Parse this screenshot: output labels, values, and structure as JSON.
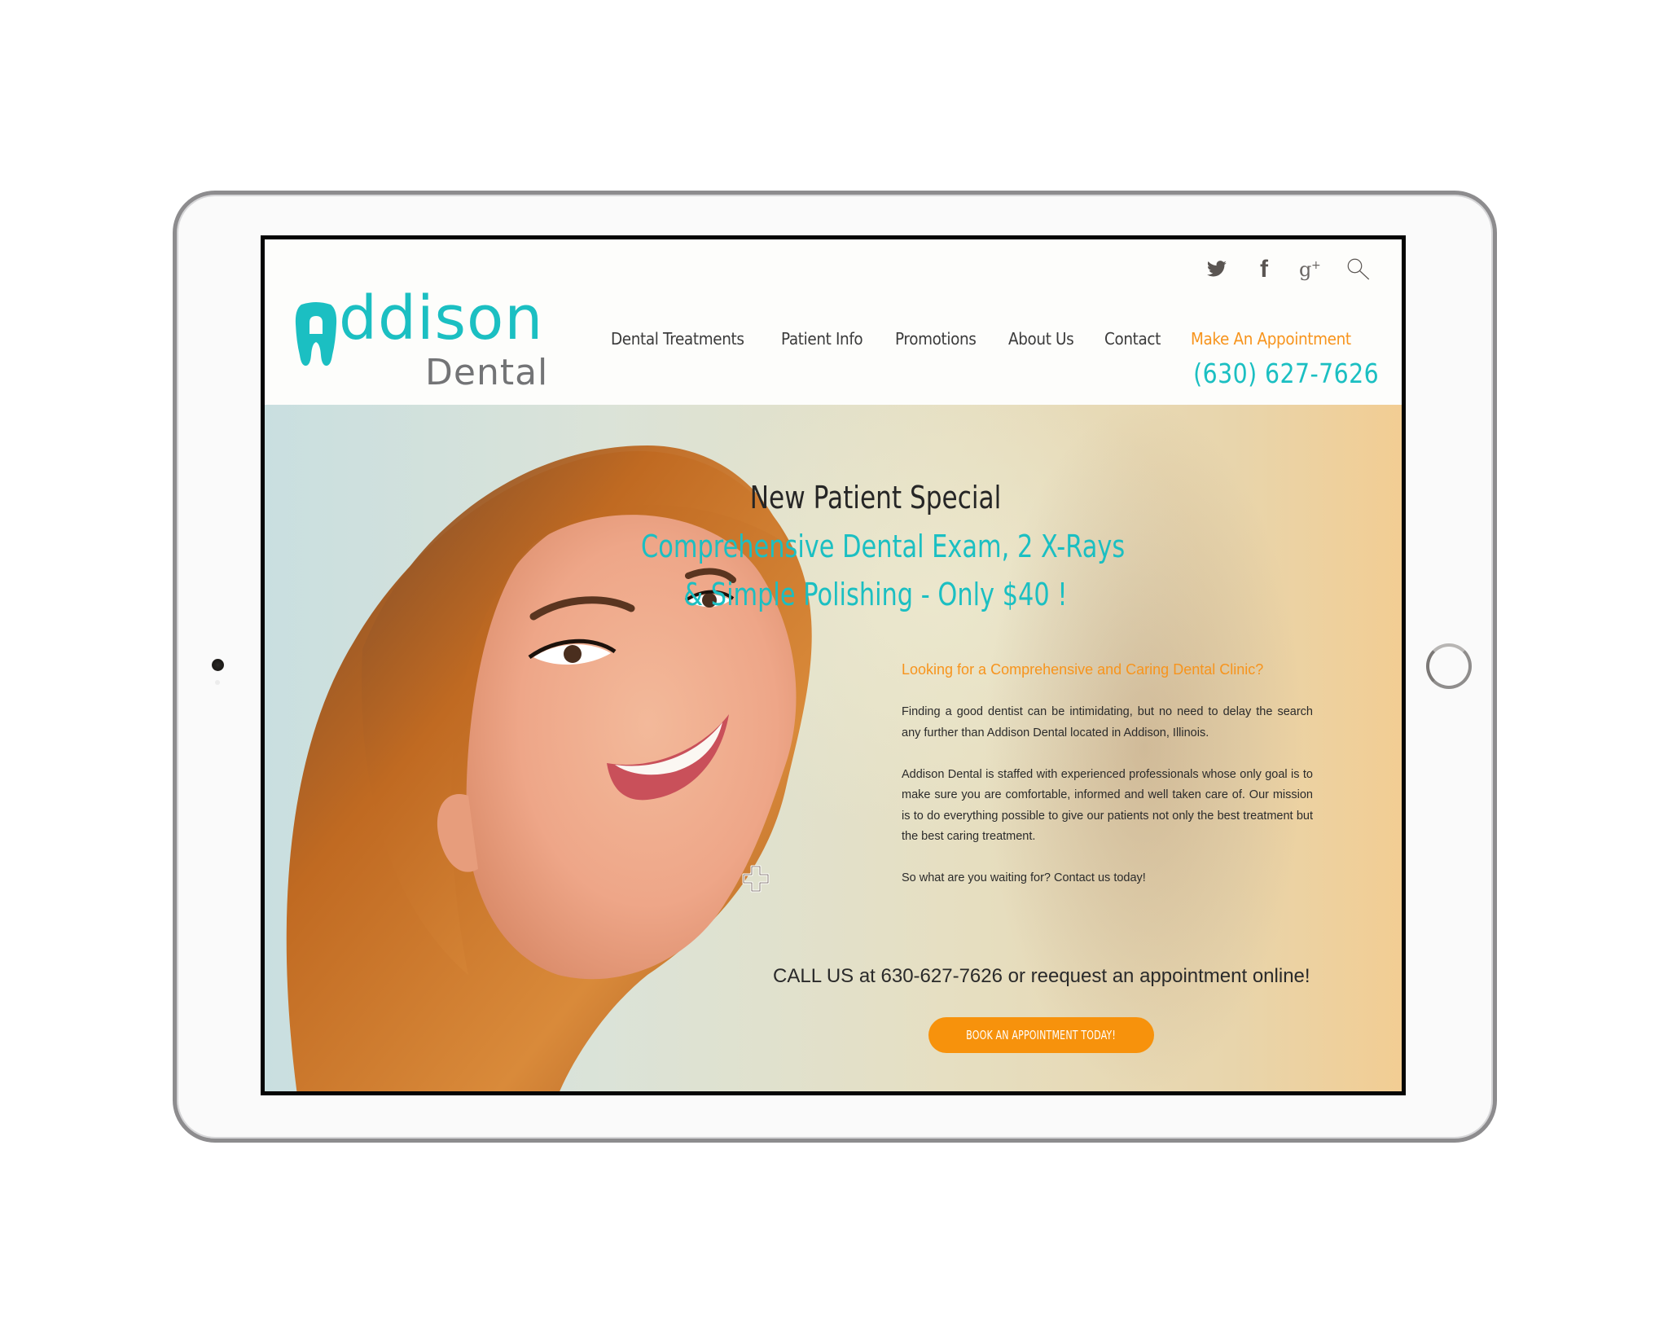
{
  "site": {
    "logo": {
      "word": "ddison",
      "first_letter_icon": "tooth-icon",
      "sub": "Dental",
      "alt": "Addison Dental"
    },
    "social": [
      {
        "name": "twitter-icon"
      },
      {
        "name": "facebook-icon",
        "glyph": "f"
      },
      {
        "name": "google-plus-icon",
        "glyph": "g+"
      },
      {
        "name": "search-icon"
      }
    ],
    "nav": [
      {
        "label": "Dental Treatments"
      },
      {
        "label": "Patient Info"
      },
      {
        "label": "Promotions"
      },
      {
        "label": "About Us"
      },
      {
        "label": "Contact"
      },
      {
        "label": "Make An Appointment"
      }
    ],
    "phone": "(630) 627-7626"
  },
  "hero": {
    "title": "New Patient Special",
    "offer_line_1": "Comprehensive Dental Exam, 2 X-Rays",
    "offer_line_2": "& Simple Polishing - Only $40 !",
    "sub_heading": "Looking for a Comprehensive and Caring Dental Clinic?",
    "paragraphs": [
      "Finding a good dentist can be intimidating, but no need to delay the search any further than Addison Dental located in Addison, Illinois.",
      "Addison Dental is staffed with experienced professionals whose only goal is to make sure you are comfortable, informed and well taken care of. Our mission is to do everything possible to give our patients not only the best treatment but the best caring treatment.",
      "So what are you waiting for? Contact us today!"
    ],
    "call_us": "CALL US at 630-627-7626 or reequest an appointment online!",
    "cta_label": "BOOK AN APPOINTMENT TODAY!"
  },
  "colors": {
    "brand_teal": "#1bbfc2",
    "accent_orange": "#f7941d",
    "button_orange": "#f7920c",
    "logo_gray": "#737476",
    "text_dark": "#2b2b2b"
  }
}
